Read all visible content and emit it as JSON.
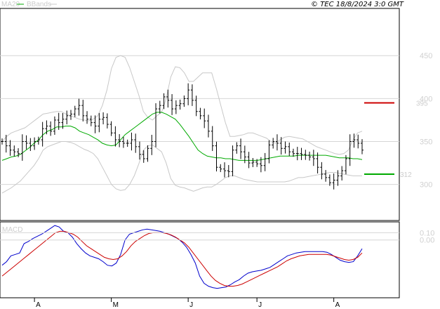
{
  "header": {
    "ma_label": "MA20",
    "bb_label": "BBands",
    "copyright": "© TEC 18/8/2024 3:0 GMT"
  },
  "colors": {
    "ma": "#00aa00",
    "bbands": "#c8c8c8",
    "bars": "#000000",
    "macd": "#0000cc",
    "signal": "#cc0000",
    "resistance": "#cc0000",
    "support": "#00aa00",
    "grid": "#d6d6d6"
  },
  "chart_data": [
    {
      "type": "ohlc",
      "title": "",
      "y_ticks": [
        300,
        350,
        400,
        450
      ],
      "y_tick_labels": [
        "300",
        "350",
        "400",
        "450"
      ],
      "ylim": [
        258,
        505
      ],
      "x_count": 90,
      "x_month_labels": [
        {
          "index": 8,
          "label": "A"
        },
        {
          "index": 27,
          "label": "M"
        },
        {
          "index": 46,
          "label": "J"
        },
        {
          "index": 63,
          "label": "J"
        },
        {
          "index": 82,
          "label": "A"
        }
      ],
      "resistance": {
        "value": 395,
        "label": "395"
      },
      "support": {
        "value": 312,
        "label": "312"
      },
      "legend": [
        "MA20",
        "BBands"
      ],
      "closes": [
        350,
        345,
        340,
        338,
        336,
        350,
        348,
        345,
        350,
        352,
        365,
        368,
        362,
        375,
        372,
        376,
        380,
        382,
        388,
        392,
        380,
        376,
        372,
        368,
        376,
        378,
        370,
        360,
        352,
        350,
        348,
        348,
        352,
        344,
        335,
        330,
        342,
        350,
        388,
        392,
        402,
        398,
        388,
        392,
        394,
        400,
        410,
        398,
        385,
        380,
        374,
        362,
        345,
        320,
        318,
        316,
        315,
        340,
        345,
        338,
        332,
        325,
        326,
        324,
        322,
        330,
        346,
        350,
        348,
        342,
        344,
        338,
        336,
        336,
        335,
        334,
        332,
        330,
        320,
        312,
        308,
        302,
        305,
        310,
        316,
        330,
        350,
        352,
        348,
        340
      ],
      "ma20": [
        328,
        330,
        332,
        333,
        335,
        339,
        343,
        348,
        352,
        358,
        362,
        364,
        367,
        367,
        368,
        368,
        366,
        362,
        360,
        358,
        355,
        352,
        348,
        346,
        345,
        346,
        352,
        358,
        362,
        366,
        370,
        374,
        378,
        382,
        384,
        384,
        382,
        379,
        376,
        370,
        363,
        356,
        348,
        340,
        336,
        333,
        332,
        331,
        331,
        330,
        330,
        329,
        328,
        328,
        328,
        328,
        328,
        329,
        330,
        331,
        332,
        333,
        333,
        333,
        333,
        334,
        334,
        334,
        334,
        334,
        334,
        334,
        333,
        332,
        331,
        331,
        331,
        330,
        330,
        329
      ],
      "bb_upper": [
        350,
        356,
        360,
        362,
        364,
        366,
        370,
        374,
        378,
        382,
        383,
        384,
        385,
        385,
        382,
        380,
        378,
        376,
        375,
        374,
        376,
        380,
        392,
        410,
        435,
        448,
        450,
        448,
        436,
        420,
        404,
        385,
        378,
        375,
        380,
        384,
        400,
        425,
        437,
        436,
        430,
        420,
        420,
        425,
        430,
        430,
        430,
        412,
        392,
        372,
        356,
        356,
        357,
        358,
        360,
        360,
        358,
        356,
        354,
        350,
        348,
        352,
        355,
        356,
        355,
        354,
        353,
        350,
        347,
        344,
        342,
        340,
        338,
        336,
        335,
        336,
        340,
        352,
        360,
        362
      ],
      "bb_lower": [
        290,
        293,
        296,
        300,
        304,
        310,
        316,
        322,
        330,
        340,
        344,
        346,
        348,
        350,
        350,
        349,
        347,
        344,
        341,
        339,
        336,
        330,
        320,
        310,
        300,
        295,
        293,
        294,
        300,
        310,
        324,
        340,
        345,
        346,
        342,
        338,
        325,
        307,
        299,
        297,
        296,
        294,
        292,
        294,
        296,
        297,
        297,
        300,
        304,
        308,
        310,
        310,
        308,
        306,
        305,
        304,
        303,
        303,
        303,
        303,
        303,
        303,
        303,
        304,
        306,
        308,
        308,
        309,
        310,
        311,
        312,
        313,
        314,
        314,
        313,
        312,
        311,
        310,
        310,
        310
      ],
      "notes": [
        "Y grid lines at 300, 350, 400, 450 across price panel."
      ]
    },
    {
      "type": "line",
      "title": "MACD",
      "y_ticks": [
        0,
        10
      ],
      "y_tick_labels": [
        "0.00",
        "0.10"
      ],
      "ylim": [
        -0.8,
        0.25
      ],
      "series": [
        {
          "name": "",
          "values": [
            -0.35,
            -0.3,
            -0.22,
            -0.2,
            -0.18,
            -0.05,
            -0.02,
            0.02,
            0.05,
            0.08,
            0.12,
            0.16,
            0.2,
            0.18,
            0.12,
            0.1,
            0.04,
            -0.05,
            -0.12,
            -0.18,
            -0.22,
            -0.24,
            -0.26,
            -0.3,
            -0.35,
            -0.36,
            -0.32,
            -0.2,
            0.0,
            0.08,
            0.1,
            0.12,
            0.14,
            0.15,
            0.14,
            0.13,
            0.12,
            0.1,
            0.08,
            0.05,
            0.02,
            -0.03,
            -0.1,
            -0.2,
            -0.32,
            -0.5,
            -0.6,
            -0.64,
            -0.66,
            -0.67,
            -0.66,
            -0.65,
            -0.62,
            -0.58,
            -0.55,
            -0.5,
            -0.46,
            -0.44,
            -0.43,
            -0.42,
            -0.4,
            -0.38,
            -0.34,
            -0.3,
            -0.26,
            -0.22,
            -0.2,
            -0.18,
            -0.17,
            -0.16,
            -0.16,
            -0.16,
            -0.16,
            -0.16,
            -0.17,
            -0.2,
            -0.24,
            -0.28,
            -0.3,
            -0.31,
            -0.3,
            -0.22,
            -0.12
          ]
        },
        {
          "name": "",
          "values": [
            -0.5,
            -0.45,
            -0.4,
            -0.35,
            -0.3,
            -0.25,
            -0.2,
            -0.15,
            -0.1,
            -0.05,
            0.0,
            0.05,
            0.1,
            0.12,
            0.12,
            0.1,
            0.08,
            0.04,
            -0.02,
            -0.08,
            -0.12,
            -0.16,
            -0.2,
            -0.24,
            -0.26,
            -0.27,
            -0.26,
            -0.22,
            -0.16,
            -0.08,
            -0.02,
            0.02,
            0.06,
            0.09,
            0.1,
            0.1,
            0.1,
            0.09,
            0.07,
            0.04,
            0.0,
            -0.04,
            -0.1,
            -0.18,
            -0.26,
            -0.34,
            -0.42,
            -0.5,
            -0.56,
            -0.6,
            -0.63,
            -0.64,
            -0.64,
            -0.63,
            -0.61,
            -0.58,
            -0.55,
            -0.52,
            -0.49,
            -0.46,
            -0.43,
            -0.4,
            -0.37,
            -0.33,
            -0.29,
            -0.26,
            -0.24,
            -0.22,
            -0.21,
            -0.2,
            -0.2,
            -0.2,
            -0.2,
            -0.2,
            -0.21,
            -0.23,
            -0.25,
            -0.27,
            -0.28,
            -0.27,
            -0.24,
            -0.18
          ]
        }
      ]
    }
  ]
}
